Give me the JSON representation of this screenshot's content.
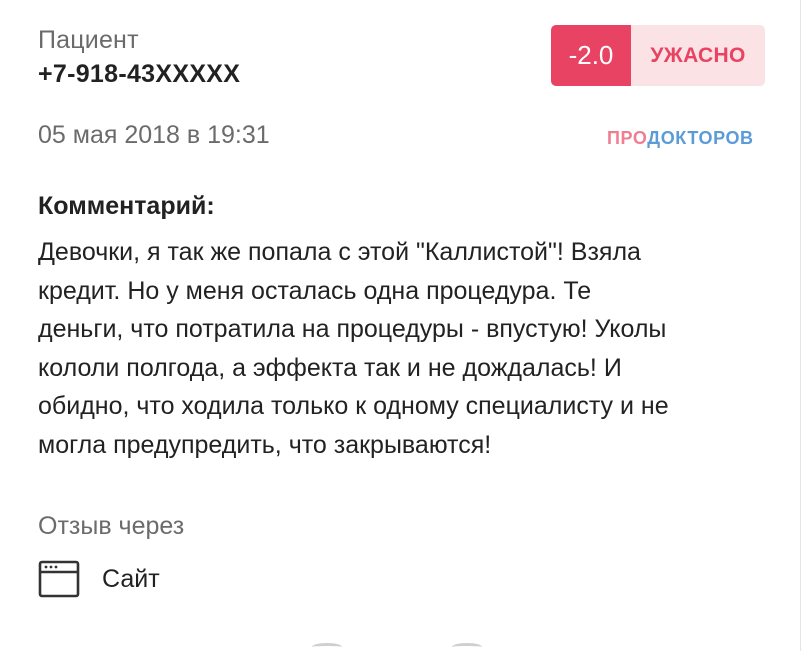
{
  "review": {
    "author_label": "Пациент",
    "author_phone": "+7-918-43XXXXX",
    "rating": {
      "score": "-2.0",
      "verdict": "УЖАСНО",
      "score_color": "#e84362",
      "verdict_bg_color": "#fbe2e5"
    },
    "date": "05 мая 2018 в 19:31",
    "brand": {
      "part1": "ПРО",
      "part2": "ДОКТОРОВ"
    },
    "comment_title": "Комментарий:",
    "comment_lines": [
      "Девочки, я так же попала с этой \"Каллистой\"! Взяла",
      "кредит. Но у меня осталась одна процедура. Те",
      "деньги, что потратила на процедуры - впустую! Уколы",
      "кололи полгода, а эффекта так и не дождалась! И",
      "обидно, что ходила только к одному специалисту и не",
      "могла предупредить, что закрываются!"
    ],
    "via_label": "Отзыв через",
    "source": {
      "icon": "browser-window-icon",
      "label": "Сайт"
    }
  }
}
